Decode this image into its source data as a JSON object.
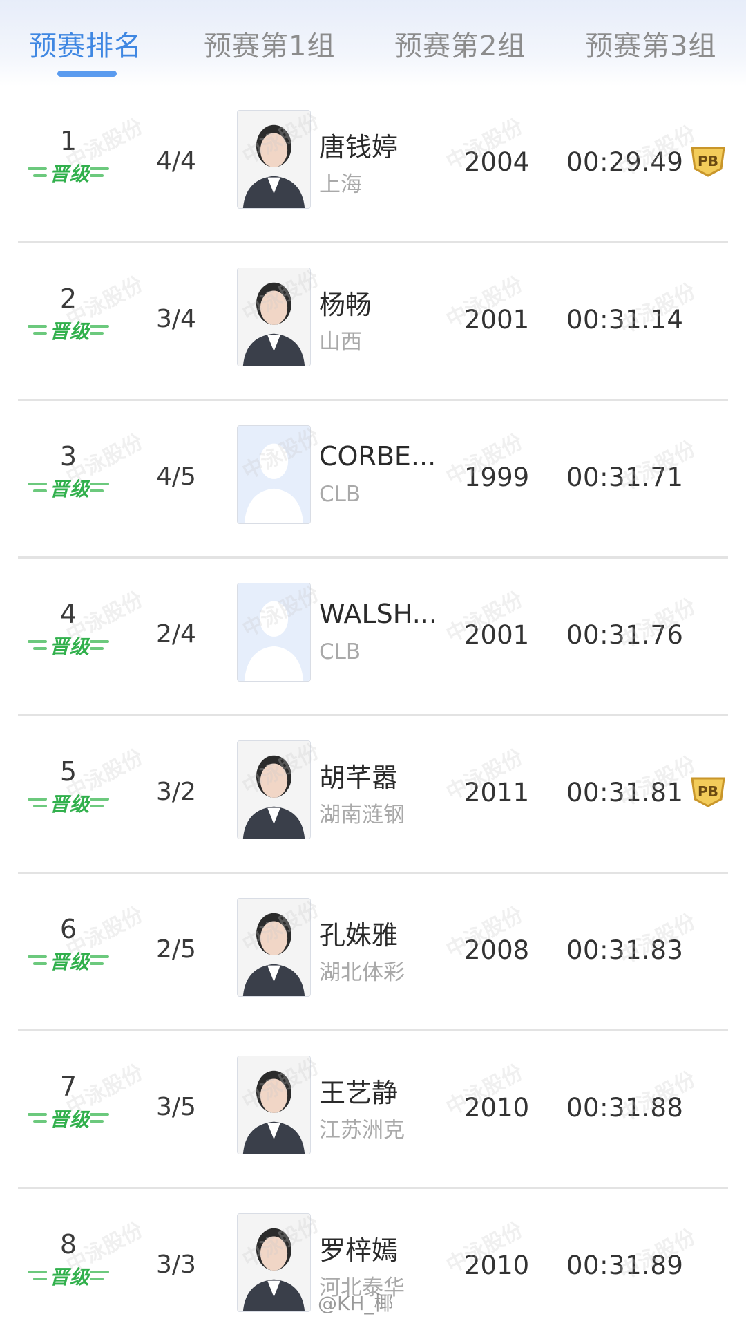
{
  "tabs": [
    {
      "label": "预赛排名",
      "active": true
    },
    {
      "label": "预赛第1组",
      "active": false
    },
    {
      "label": "预赛第2组",
      "active": false
    },
    {
      "label": "预赛第3组",
      "active": false
    }
  ],
  "qualified_label": "晋级",
  "pb_label": "PB",
  "watermark": "中泳股份",
  "footer_watermark": "@KH_椰",
  "rows": [
    {
      "rank": "1",
      "lane": "4/4",
      "name": "唐钱婷",
      "team": "上海",
      "year": "2004",
      "time": "00:29.49",
      "pb": true,
      "photo": "person"
    },
    {
      "rank": "2",
      "lane": "3/4",
      "name": "杨畅",
      "team": "山西",
      "year": "2001",
      "time": "00:31.14",
      "pb": false,
      "photo": "person"
    },
    {
      "rank": "3",
      "lane": "4/5",
      "name": "CORBE...",
      "team": "CLB",
      "year": "1999",
      "time": "00:31.71",
      "pb": false,
      "photo": "placeholder"
    },
    {
      "rank": "4",
      "lane": "2/4",
      "name": "WALSH...",
      "team": "CLB",
      "year": "2001",
      "time": "00:31.76",
      "pb": false,
      "photo": "placeholder"
    },
    {
      "rank": "5",
      "lane": "3/2",
      "name": "胡芊嚣",
      "team": "湖南涟钢",
      "year": "2011",
      "time": "00:31.81",
      "pb": true,
      "photo": "person"
    },
    {
      "rank": "6",
      "lane": "2/5",
      "name": "孔姝雅",
      "team": "湖北体彩",
      "year": "2008",
      "time": "00:31.83",
      "pb": false,
      "photo": "person"
    },
    {
      "rank": "7",
      "lane": "3/5",
      "name": "王艺静",
      "team": "江苏洲克",
      "year": "2010",
      "time": "00:31.88",
      "pb": false,
      "photo": "person"
    },
    {
      "rank": "8",
      "lane": "3/3",
      "name": "罗梓嫣",
      "team": "河北泰华",
      "year": "2010",
      "time": "00:31.89",
      "pb": false,
      "photo": "person"
    }
  ],
  "colors": {
    "tab_active": "#3f87e2",
    "tab_inactive": "#8c8c8c",
    "qualified_green": "#31b04c",
    "pb_gold": "#e2b13c"
  }
}
